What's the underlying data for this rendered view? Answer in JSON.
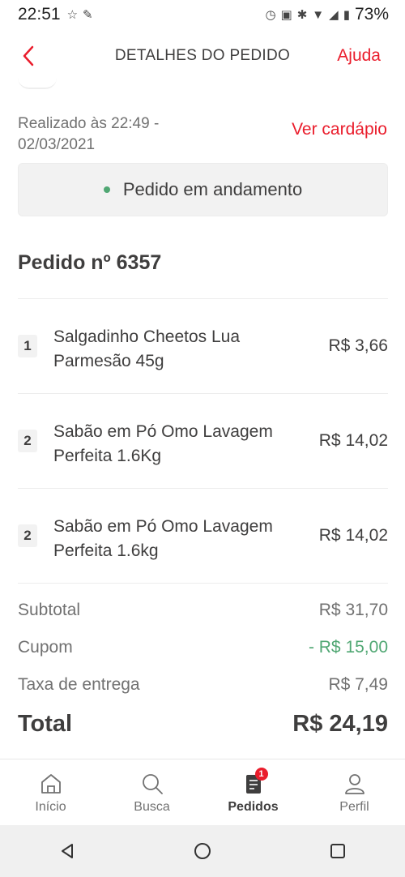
{
  "status_bar": {
    "time": "22:51",
    "battery": "73%"
  },
  "header": {
    "title": "DETALHES DO PEDIDO",
    "help": "Ajuda"
  },
  "order": {
    "placed_line1": "Realizado às 22:49 -",
    "placed_line2": "02/03/2021",
    "menu_link": "Ver cardápio",
    "status": "Pedido em andamento",
    "number": "Pedido nº 6357"
  },
  "items": [
    {
      "qty": "1",
      "name": "Salgadinho Cheetos Lua Parmesão 45g",
      "price": "R$ 3,66"
    },
    {
      "qty": "2",
      "name": "Sabão em Pó Omo Lavagem Perfeita 1.6Kg",
      "price": "R$ 14,02"
    },
    {
      "qty": "2",
      "name": "Sabão em Pó Omo Lavagem Perfeita 1.6kg",
      "price": "R$ 14,02"
    }
  ],
  "summary": {
    "subtotal_label": "Subtotal",
    "subtotal_value": "R$ 31,70",
    "coupon_label": "Cupom",
    "coupon_value": "- R$ 15,00",
    "delivery_label": "Taxa de entrega",
    "delivery_value": "R$ 7,49",
    "total_label": "Total",
    "total_value": "R$ 24,19"
  },
  "tabbar": {
    "tabs": [
      {
        "label": "Início",
        "icon": "home-icon"
      },
      {
        "label": "Busca",
        "icon": "search-icon"
      },
      {
        "label": "Pedidos",
        "icon": "orders-icon",
        "badge": "1"
      },
      {
        "label": "Perfil",
        "icon": "profile-icon"
      }
    ]
  },
  "colors": {
    "accent": "#ea1d2c",
    "success": "#50a773",
    "text": "#3f3e3e",
    "muted": "#717171"
  }
}
